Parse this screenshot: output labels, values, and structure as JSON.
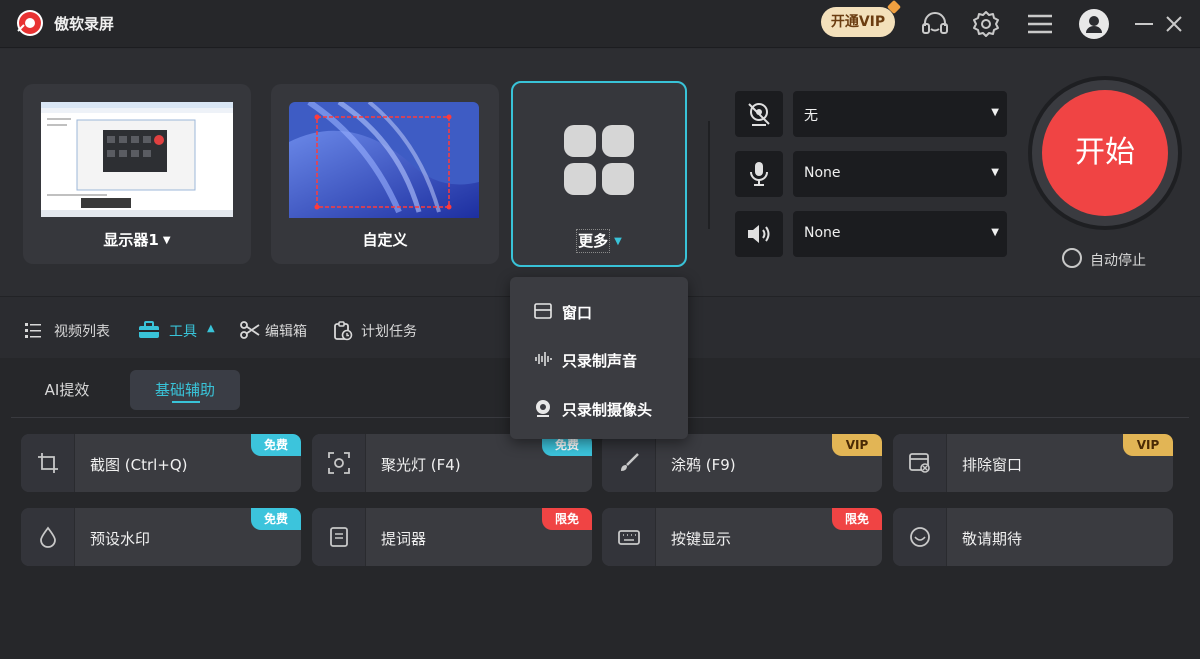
{
  "titlebar": {
    "app_name": "傲软录屏",
    "vip_label": "开通VIP",
    "icons": [
      "app-logo",
      "headset-icon",
      "settings-gear-icon",
      "menu-icon",
      "user-avatar-icon",
      "minimize-icon",
      "close-icon"
    ]
  },
  "sources": [
    {
      "label": "显示器1",
      "has_caret": true
    },
    {
      "label": "自定义",
      "has_caret": false
    },
    {
      "label": "更多",
      "has_caret": true
    }
  ],
  "devices": {
    "camera": {
      "value": "无",
      "icon": "camera-off-icon"
    },
    "microphone": {
      "value": "None",
      "icon": "microphone-icon"
    },
    "speaker": {
      "value": "None",
      "icon": "speaker-icon"
    }
  },
  "start": {
    "label": "开始",
    "autostop_label": "自动停止"
  },
  "toolbar_tabs": [
    {
      "label": "视频列表",
      "icon": "list-icon",
      "active": false
    },
    {
      "label": "工具",
      "icon": "toolbox-icon",
      "active": true
    },
    {
      "label": "编辑箱",
      "icon": "scissors-icon",
      "active": false
    },
    {
      "label": "计划任务",
      "icon": "schedule-icon",
      "active": false
    }
  ],
  "subtabs": [
    {
      "label": "AI提效",
      "active": false
    },
    {
      "label": "基础辅助",
      "active": true
    }
  ],
  "features": [
    {
      "label": "截图 (Ctrl+Q)",
      "icon": "crop-icon",
      "badge": "免费",
      "badge_type": "free"
    },
    {
      "label": "聚光灯 (F4)",
      "icon": "spotlight-icon",
      "badge": "免费",
      "badge_type": "free"
    },
    {
      "label": "涂鸦 (F9)",
      "icon": "brush-icon",
      "badge": "VIP",
      "badge_type": "vip"
    },
    {
      "label": "排除窗口",
      "icon": "exclude-window-icon",
      "badge": "VIP",
      "badge_type": "vip"
    },
    {
      "label": "预设水印",
      "icon": "watermark-drop-icon",
      "badge": "免费",
      "badge_type": "free"
    },
    {
      "label": "提词器",
      "icon": "teleprompter-icon",
      "badge": "限免",
      "badge_type": "limit"
    },
    {
      "label": "按键显示",
      "icon": "keyboard-icon",
      "badge": "限免",
      "badge_type": "limit"
    },
    {
      "label": "敬请期待",
      "icon": "smile-icon",
      "badge": "",
      "badge_type": ""
    }
  ],
  "more_menu": [
    {
      "label": "窗口",
      "icon": "window-icon"
    },
    {
      "label": "只录制声音",
      "icon": "audio-wave-icon"
    },
    {
      "label": "只录制摄像头",
      "icon": "webcam-icon"
    }
  ],
  "colors": {
    "accent": "#39c3d8",
    "start_red": "#f04444",
    "vip_gold": "#e2b555",
    "free_blue": "#3cc4dc",
    "background": "#2b2c30"
  }
}
